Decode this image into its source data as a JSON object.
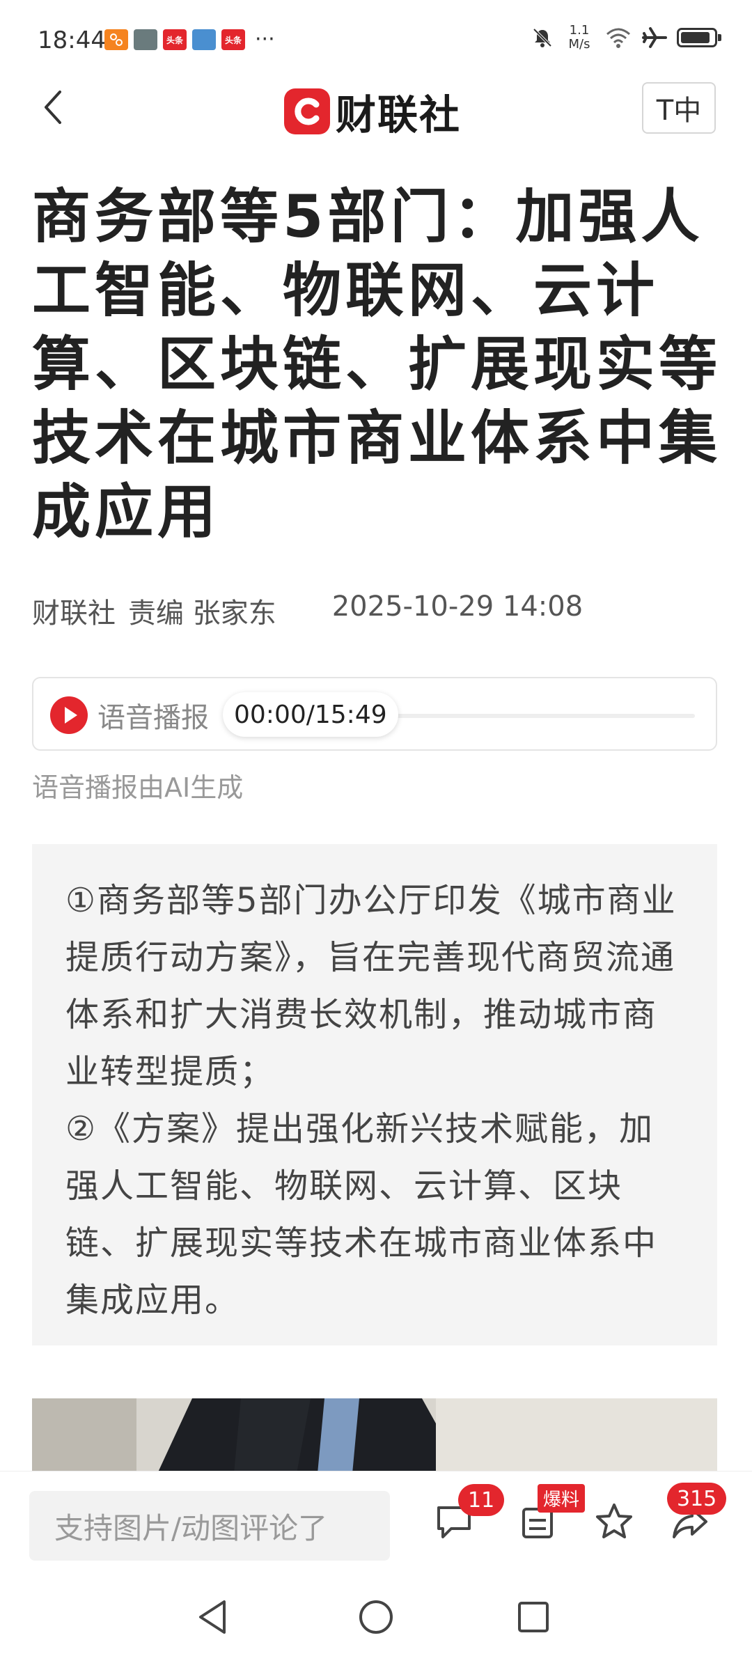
{
  "status_bar": {
    "time": "18:44",
    "net_speed_value": "1.1",
    "net_speed_unit": "M/s",
    "notif_labels": [
      "头条",
      "头条"
    ],
    "battery_level": 0.9
  },
  "header": {
    "logo_text": "财联社",
    "logo_mark": "C",
    "font_size_button": "T中"
  },
  "article": {
    "title": "商务部等5部门：加强人工智能、物联网、云计算、区块链、扩展现实等技术在城市商业体系中集成应用",
    "source": "财联社",
    "editor": "责编 张家东",
    "date": "2025-10-29 14:08",
    "audio": {
      "label": "语音播报",
      "time": "00:00/15:49",
      "note": "语音播报由AI生成",
      "progress": 0
    },
    "summary": [
      "①商务部等5部门办公厅印发《城市商业提质行动方案》，旨在完善现代商贸流通体系和扩大消费长效机制，推动城市商业转型提质；",
      "②《方案》提出强化新兴技术赋能，加强人工智能、物联网、云计算、区块链、扩展现实等技术在城市商业体系中集成应用。"
    ]
  },
  "bottom_bar": {
    "comment_placeholder": "支持图片/动图评论了",
    "comment_count": "11",
    "baoliao_label": "爆料",
    "share_count": "315"
  },
  "colors": {
    "brand_red": "#e3262d",
    "summary_bg": "#f4f4f4"
  }
}
